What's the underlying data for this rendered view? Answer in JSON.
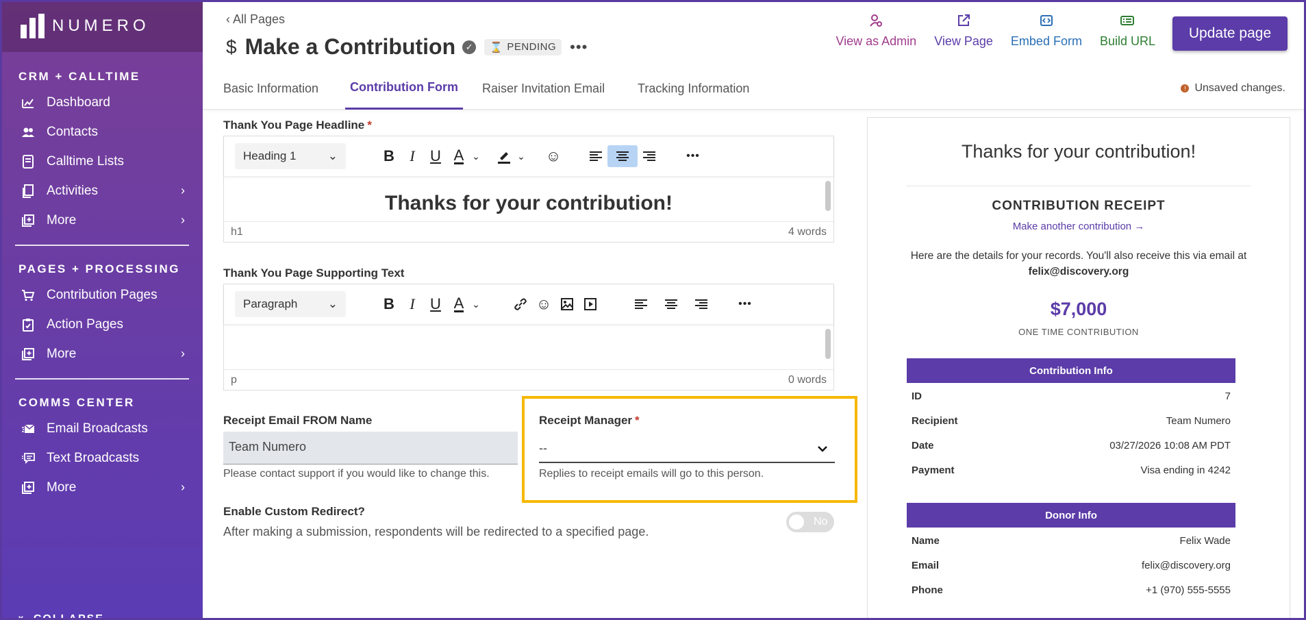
{
  "brand": {
    "name": "NUMERO"
  },
  "sidebar": {
    "sections": [
      {
        "title": "CRM + CALLTIME",
        "items": [
          {
            "label": "Dashboard",
            "icon": "chart-icon",
            "chevron": false
          },
          {
            "label": "Contacts",
            "icon": "people-icon",
            "chevron": false
          },
          {
            "label": "Calltime Lists",
            "icon": "phone-list-icon",
            "chevron": false
          },
          {
            "label": "Activities",
            "icon": "clipboard-icon",
            "chevron": true
          },
          {
            "label": "More",
            "icon": "plus-square-icon",
            "chevron": true
          }
        ]
      },
      {
        "title": "PAGES + PROCESSING",
        "items": [
          {
            "label": "Contribution Pages",
            "icon": "cart-icon",
            "chevron": false
          },
          {
            "label": "Action Pages",
            "icon": "clipboard-check-icon",
            "chevron": false
          },
          {
            "label": "More",
            "icon": "plus-square-icon",
            "chevron": true
          }
        ]
      },
      {
        "title": "COMMS CENTER",
        "items": [
          {
            "label": "Email Broadcasts",
            "icon": "email-icon",
            "chevron": false
          },
          {
            "label": "Text Broadcasts",
            "icon": "chat-icon",
            "chevron": false
          },
          {
            "label": "More",
            "icon": "plus-square-icon",
            "chevron": true
          }
        ]
      }
    ],
    "collapse_label": "COLLAPSE"
  },
  "header": {
    "back_label": "‹ All Pages",
    "title": "Make a Contribution",
    "status": "PENDING",
    "actions": [
      {
        "label": "View as Admin",
        "color": "#a03c8c"
      },
      {
        "label": "View Page",
        "color": "#5b3ca8"
      },
      {
        "label": "Embed Form",
        "color": "#2a6fb5"
      },
      {
        "label": "Build URL",
        "color": "#2e7d32"
      }
    ],
    "update_label": "Update page"
  },
  "tabs": [
    {
      "label": "Basic Information",
      "active": false
    },
    {
      "label": "Contribution Form",
      "active": true
    },
    {
      "label": "Raiser Invitation Email",
      "active": false
    },
    {
      "label": "Tracking Information",
      "active": false
    }
  ],
  "unsaved_label": "Unsaved changes.",
  "form": {
    "headline": {
      "label": "Thank You Page Headline",
      "block_type": "Heading 1",
      "content": "Thanks for your contribution!",
      "tag": "h1",
      "word_count": "4 words"
    },
    "supporting": {
      "label": "Thank You Page Supporting Text",
      "block_type": "Paragraph",
      "content": "",
      "tag": "p",
      "word_count": "0 words"
    },
    "from_name": {
      "label": "Receipt Email FROM Name",
      "value": "Team Numero",
      "help": "Please contact support if you would like to change this."
    },
    "receipt_manager": {
      "label": "Receipt Manager",
      "value": "--",
      "help": "Replies to receipt emails will go to this person."
    },
    "redirect": {
      "label": "Enable Custom Redirect?",
      "help": "After making a submission, respondents will be redirected to a specified page.",
      "toggle_label": "No"
    }
  },
  "preview": {
    "title": "Thanks for your contribution!",
    "receipt_title": "CONTRIBUTION RECEIPT",
    "another_link": "Make another contribution →",
    "details_text": "Here are the details for your records. You'll also receive this via email at",
    "email": "felix@discovery.org",
    "amount": "$7,000",
    "type": "ONE TIME CONTRIBUTION",
    "contribution_info_title": "Contribution Info",
    "contribution_info": [
      {
        "k": "ID",
        "v": "7"
      },
      {
        "k": "Recipient",
        "v": "Team Numero"
      },
      {
        "k": "Date",
        "v": "03/27/2026 10:08 AM PDT"
      },
      {
        "k": "Payment",
        "v": "Visa ending in 4242"
      }
    ],
    "donor_info_title": "Donor Info",
    "donor_info": [
      {
        "k": "Name",
        "v": "Felix Wade"
      },
      {
        "k": "Email",
        "v": "felix@discovery.org"
      },
      {
        "k": "Phone",
        "v": "+1 (970) 555-5555"
      }
    ]
  },
  "colors": {
    "brand": "#5b3ca8",
    "highlight": "#f5b800"
  }
}
